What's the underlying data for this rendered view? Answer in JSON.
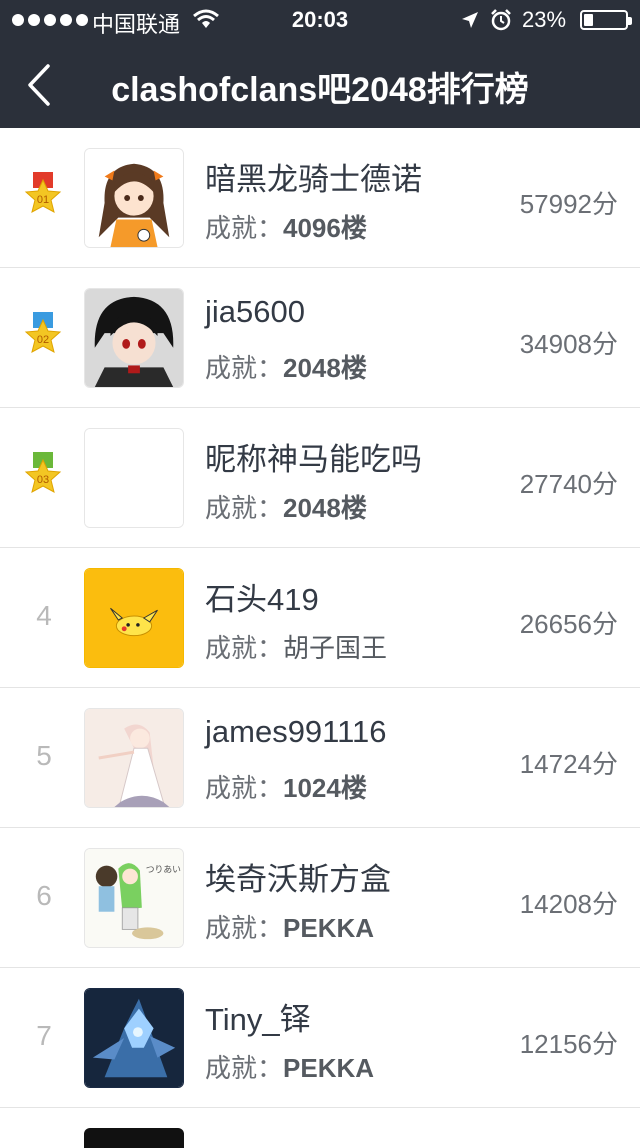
{
  "status_bar": {
    "carrier": "中国联通",
    "time": "20:03",
    "battery_pct": "23%",
    "battery_level": 0.23,
    "icons": [
      "signal-dots-icon",
      "wifi-icon",
      "location-arrow-icon",
      "alarm-clock-icon",
      "battery-icon"
    ]
  },
  "nav": {
    "title": "clashofclans吧2048排行榜",
    "back_icon": "chevron-left-icon"
  },
  "achievement_label": "成就：",
  "colors": {
    "nav_bg": "#2b303a",
    "medal_gold": "#e23b2a",
    "medal_silver": "#3a9be0",
    "medal_bronze": "#6bb83a",
    "star": "#f3c623"
  },
  "rows": [
    {
      "rank": "01",
      "medal": "gold",
      "name": "暗黑龙骑士德诺",
      "achievement": "4096楼",
      "score": "57992分",
      "avatar": "anime-girl-avatar"
    },
    {
      "rank": "02",
      "medal": "silver",
      "name": "jia5600",
      "achievement": "2048楼",
      "score": "34908分",
      "avatar": "dark-hair-boy-avatar"
    },
    {
      "rank": "03",
      "medal": "bronze",
      "name": "昵称神马能吃吗",
      "achievement": "2048楼",
      "score": "27740分",
      "avatar": "blank-avatar"
    },
    {
      "rank": "4",
      "medal": "",
      "name": "石头419",
      "achievement": "胡子国王",
      "score": "26656分",
      "avatar": "pikachu-avatar"
    },
    {
      "rank": "5",
      "medal": "",
      "name": "james991116",
      "achievement": "1024楼",
      "score": "14724分",
      "avatar": "white-dress-girl-avatar"
    },
    {
      "rank": "6",
      "medal": "",
      "name": "埃奇沃斯方盒",
      "achievement": "PEKKA",
      "score": "14208分",
      "avatar": "sketch-characters-avatar"
    },
    {
      "rank": "7",
      "medal": "",
      "name": "Tiny_铎",
      "achievement": "PEKKA",
      "score": "12156分",
      "avatar": "blue-armor-avatar"
    }
  ]
}
